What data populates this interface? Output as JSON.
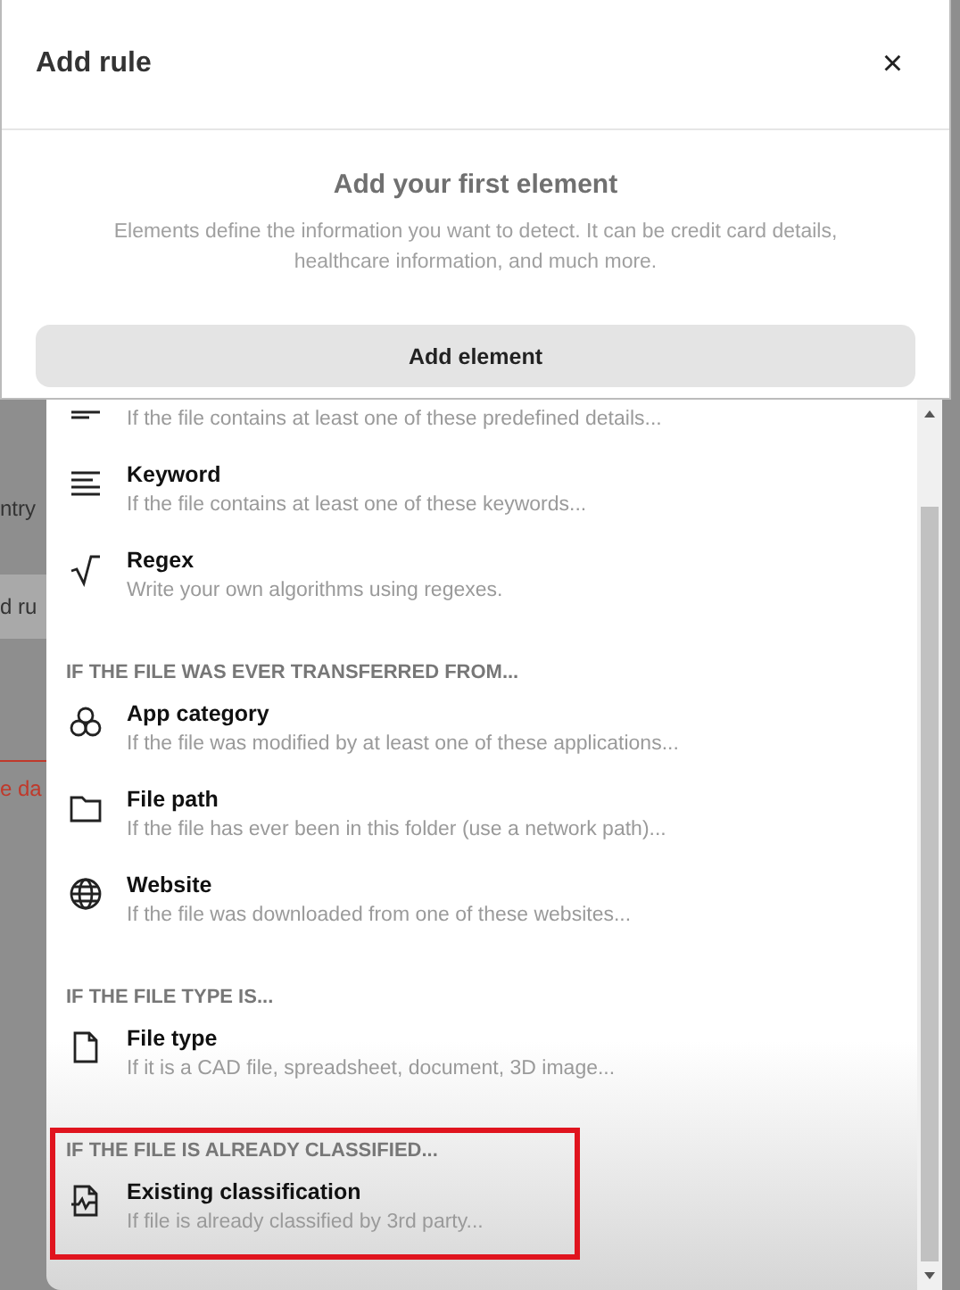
{
  "modal": {
    "title": "Add rule",
    "close": "×",
    "heading": "Add your first element",
    "description": "Elements define the information you want to detect. It can be credit card details, healthcare information, and much more.",
    "button": "Add element"
  },
  "background_fragments": [
    {
      "text": "ntry",
      "kind": "plain"
    },
    {
      "text": "d ru",
      "kind": "band"
    },
    {
      "text": "e da",
      "kind": "alert"
    }
  ],
  "dropdown": {
    "sections": [
      {
        "highlighted": false,
        "items": [
          {
            "description": "If the file contains at least one of these predefined details..."
          },
          {
            "title": "Keyword",
            "description": "If the file contains at least one of these keywords..."
          },
          {
            "title": "Regex",
            "description": "Write your own algorithms using regexes."
          }
        ]
      },
      {
        "header": "IF THE FILE WAS EVER TRANSFERRED FROM...",
        "highlighted": false,
        "items": [
          {
            "title": "App category",
            "description": "If the file was modified by at least one of these applications..."
          },
          {
            "title": "File path",
            "description": "If the file has ever been in this folder (use a network path)..."
          },
          {
            "title": "Website",
            "description": "If the file was downloaded from one of these websites..."
          }
        ]
      },
      {
        "header": "IF THE FILE TYPE IS...",
        "highlighted": false,
        "items": [
          {
            "title": "File type",
            "description": "If it is a CAD file, spreadsheet, document, 3D image..."
          }
        ]
      },
      {
        "header": "IF THE FILE IS ALREADY CLASSIFIED...",
        "highlighted": true,
        "items": [
          {
            "title": "Existing classification",
            "description": "If file is already classified by 3rd party..."
          }
        ]
      }
    ]
  }
}
